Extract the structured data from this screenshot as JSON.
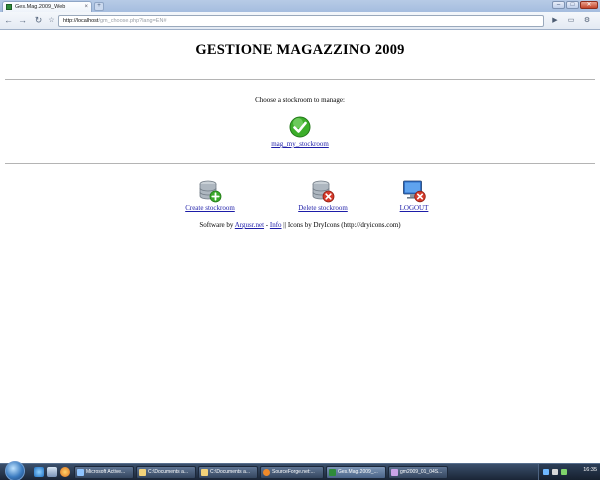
{
  "browser": {
    "tab_title": "Ges.Mag.2009_Web",
    "tab_close": "×",
    "new_tab": "+",
    "back_icon": "←",
    "forward_icon": "→",
    "reload_icon": "↻",
    "url_host": "http://localhost",
    "url_path": "/gm_choose.php?lang=EN#",
    "go_icon": "▶",
    "page_menu_icon": "▭",
    "tools_menu_icon": "⚙",
    "minimize": "–",
    "maximize": "□",
    "close": "✕"
  },
  "page": {
    "title": "GESTIONE MAGAZZINO 2009",
    "choose_prompt": "Choose a stockroom to manage:",
    "stockroom_link": "mag_my_stockroom",
    "actions": {
      "create": "Create stockroom",
      "delete": "Delete stockroom",
      "logout": "LOGOUT"
    },
    "footer": {
      "software_by": "Software by",
      "argusr_link": "Argusr.net",
      "dash": "-",
      "info_link": "Info",
      "icons_credit": "|| Icons by DryIcons (http://dryicons.com)"
    }
  },
  "taskbar": {
    "tasks": [
      "Microsoft Active...",
      "C:\\Documents a...",
      "C:\\Documents a...",
      "SourceForge.net:...",
      "Ges.Mag.2009_...",
      "gm2009_01_04S..."
    ],
    "clock": "16:35"
  },
  "colors": {
    "link": "#1d1da8",
    "check_green": "#3cae2a",
    "delete_red": "#d63a2a",
    "add_green": "#3aa82a"
  }
}
